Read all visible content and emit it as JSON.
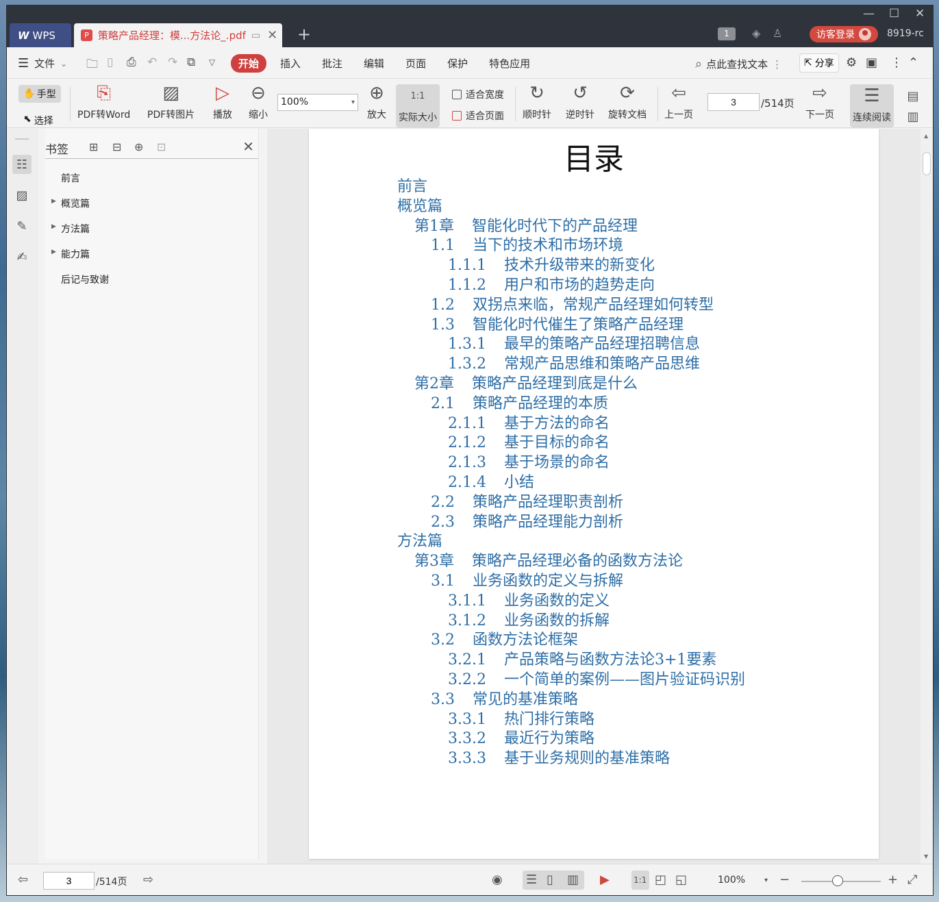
{
  "title_bar": {
    "app_tab_label": "WPS",
    "doc_tab_title": "策略产品经理：模...方法论_.pdf",
    "login_label": "访客登录",
    "user_id": "8919-rc",
    "badge_count": "1"
  },
  "menu": {
    "file_label": "文件",
    "tabs": [
      {
        "label": "开始",
        "active": true
      },
      {
        "label": "插入",
        "active": false
      },
      {
        "label": "批注",
        "active": false
      },
      {
        "label": "编辑",
        "active": false
      },
      {
        "label": "页面",
        "active": false
      },
      {
        "label": "保护",
        "active": false
      },
      {
        "label": "特色应用",
        "active": false
      }
    ],
    "search_placeholder": "点此查找文本",
    "share_label": "分享"
  },
  "toolbar": {
    "hand_label": "手型",
    "select_label": "选择",
    "pdf_to_word": "PDF转Word",
    "pdf_to_image": "PDF转图片",
    "play": "播放",
    "zoom_out": "缩小",
    "zoom_value": "100%",
    "zoom_in": "放大",
    "actual_size": "实际大小",
    "fit_width": "适合宽度",
    "fit_page": "适合页面",
    "clockwise": "顺时针",
    "counterclockwise": "逆时针",
    "rotate_doc": "旋转文档",
    "prev_page": "上一页",
    "current_page": "3",
    "total_pages": "/514页",
    "next_page": "下一页",
    "continuous_read": "连续阅读"
  },
  "bookmarks": {
    "title": "书签",
    "items": [
      {
        "label": "前言",
        "expandable": false
      },
      {
        "label": "概览篇",
        "expandable": true
      },
      {
        "label": "方法篇",
        "expandable": true
      },
      {
        "label": "能力篇",
        "expandable": true
      },
      {
        "label": "后记与致谢",
        "expandable": false
      }
    ]
  },
  "document": {
    "toc_heading": "目录",
    "toc": [
      {
        "level": 0,
        "num": "",
        "text": "前言"
      },
      {
        "level": 0,
        "num": "",
        "text": "概览篇"
      },
      {
        "level": 1,
        "num": "第1章",
        "text": "智能化时代下的产品经理"
      },
      {
        "level": 2,
        "num": "1.1",
        "text": "当下的技术和市场环境"
      },
      {
        "level": 3,
        "num": "1.1.1",
        "text": "技术升级带来的新变化"
      },
      {
        "level": 3,
        "num": "1.1.2",
        "text": "用户和市场的趋势走向"
      },
      {
        "level": 2,
        "num": "1.2",
        "text": "双拐点来临，常规产品经理如何转型"
      },
      {
        "level": 2,
        "num": "1.3",
        "text": "智能化时代催生了策略产品经理"
      },
      {
        "level": 3,
        "num": "1.3.1",
        "text": "最早的策略产品经理招聘信息"
      },
      {
        "level": 3,
        "num": "1.3.2",
        "text": "常规产品思维和策略产品思维"
      },
      {
        "level": 1,
        "num": "第2章",
        "text": "策略产品经理到底是什么"
      },
      {
        "level": 2,
        "num": "2.1",
        "text": "策略产品经理的本质"
      },
      {
        "level": 3,
        "num": "2.1.1",
        "text": "基于方法的命名"
      },
      {
        "level": 3,
        "num": "2.1.2",
        "text": "基于目标的命名"
      },
      {
        "level": 3,
        "num": "2.1.3",
        "text": "基于场景的命名"
      },
      {
        "level": 3,
        "num": "2.1.4",
        "text": "小结"
      },
      {
        "level": 2,
        "num": "2.2",
        "text": "策略产品经理职责剖析"
      },
      {
        "level": 2,
        "num": "2.3",
        "text": "策略产品经理能力剖析"
      },
      {
        "level": 0,
        "num": "",
        "text": "方法篇"
      },
      {
        "level": 1,
        "num": "第3章",
        "text": "策略产品经理必备的函数方法论"
      },
      {
        "level": 2,
        "num": "3.1",
        "text": "业务函数的定义与拆解"
      },
      {
        "level": 3,
        "num": "3.1.1",
        "text": "业务函数的定义"
      },
      {
        "level": 3,
        "num": "3.1.2",
        "text": "业务函数的拆解"
      },
      {
        "level": 2,
        "num": "3.2",
        "text": "函数方法论框架"
      },
      {
        "level": 3,
        "num": "3.2.1",
        "text": "产品策略与函数方法论3+1要素"
      },
      {
        "level": 3,
        "num": "3.2.2",
        "text": "一个简单的案例——图片验证码识别"
      },
      {
        "level": 2,
        "num": "3.3",
        "text": "常见的基准策略"
      },
      {
        "level": 3,
        "num": "3.3.1",
        "text": "热门排行策略"
      },
      {
        "level": 3,
        "num": "3.3.2",
        "text": "最近行为策略"
      },
      {
        "level": 3,
        "num": "3.3.3",
        "text": "基于业务规则的基准策略"
      }
    ]
  },
  "status_bar": {
    "current_page": "3",
    "total_pages": "/514页",
    "zoom": "100%"
  },
  "colors": {
    "accent": "#cf3f3f",
    "toc_link": "#2e6ea6",
    "titlebar": "#2f333b"
  }
}
